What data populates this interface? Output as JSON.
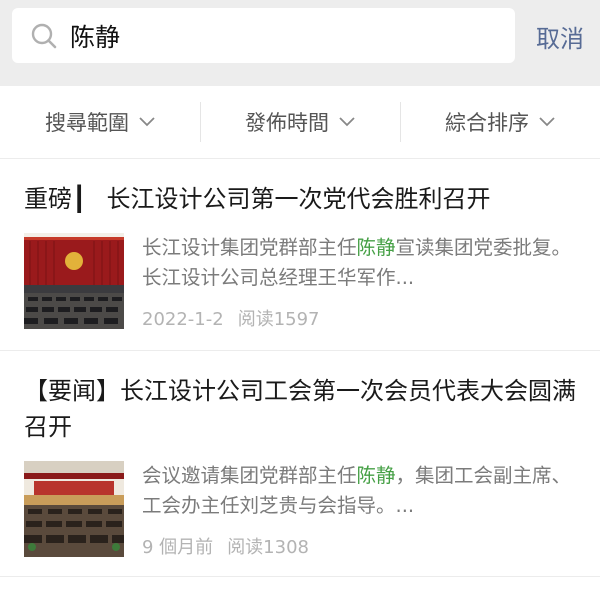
{
  "search": {
    "query": "陈静",
    "cancel_label": "取消"
  },
  "filters": [
    {
      "label": "搜尋範圍"
    },
    {
      "label": "發佈時間"
    },
    {
      "label": "綜合排序"
    }
  ],
  "results": [
    {
      "tag": "重磅┃",
      "title": "长江设计公司第一次党代会胜利召开",
      "snippet_before": "长江设计集团党群部主任",
      "snippet_highlight": "陈静",
      "snippet_after": "宣读集团党委批复。长江设计公司总经理王华军作...",
      "date": "2022-1-2",
      "reads": "阅读1597"
    },
    {
      "title": "【要闻】长江设计公司工会第一次会员代表大会圆满召开",
      "snippet_before": "会议邀请集团党群部主任",
      "snippet_highlight": "陈静",
      "snippet_after": "，集团工会副主席、工会办主任刘芝贵与会指导。...",
      "date": "9 個月前",
      "reads": "阅读1308"
    }
  ],
  "colors": {
    "highlight": "#46a046",
    "link": "#576b95"
  }
}
